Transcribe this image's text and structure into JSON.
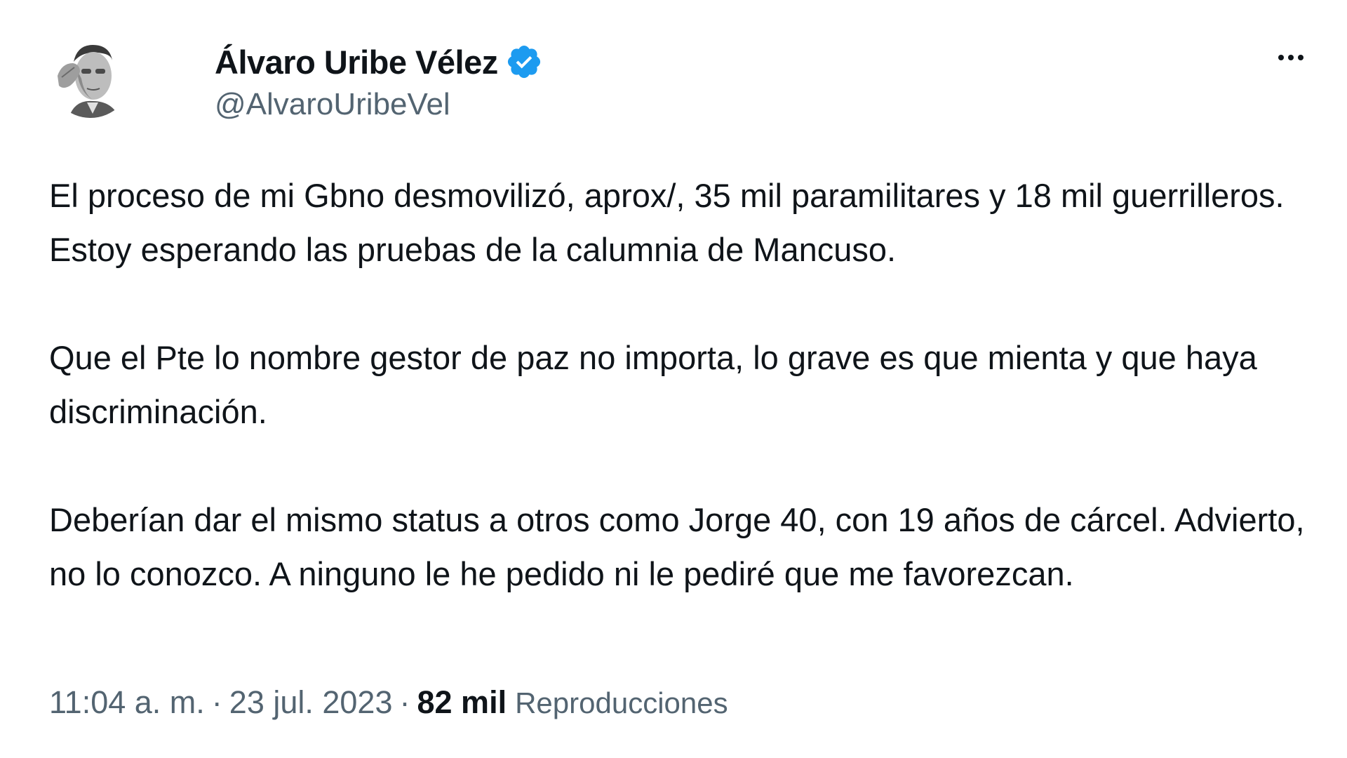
{
  "author": {
    "display_name": "Álvaro Uribe Vélez",
    "handle": "@AlvaroUribeVel",
    "verified": true,
    "verified_color": "#1d9bf0"
  },
  "menu_icon": "more-horizontal-icon",
  "tweet": {
    "paragraphs": [
      "El proceso de mi Gbno desmovilizó, aprox/, 35 mil paramilitares y 18 mil guerrilleros. Estoy esperando las pruebas de la calumnia de Mancuso.",
      "Que el Pte lo nombre gestor de paz no importa, lo grave es que mienta y que haya discriminación.",
      "Deberían dar el mismo status a otros como Jorge 40, con 19 años de cárcel. Advierto, no lo conozco. A ninguno le he pedido ni le pediré que me favorezcan."
    ]
  },
  "meta": {
    "time": "11:04 a. m.",
    "separator": "·",
    "date": "23 jul. 2023",
    "views_count": "82 mil",
    "views_label": "Reproducciones"
  },
  "colors": {
    "text_primary": "#0f1419",
    "text_secondary": "#536471",
    "background": "#ffffff"
  }
}
